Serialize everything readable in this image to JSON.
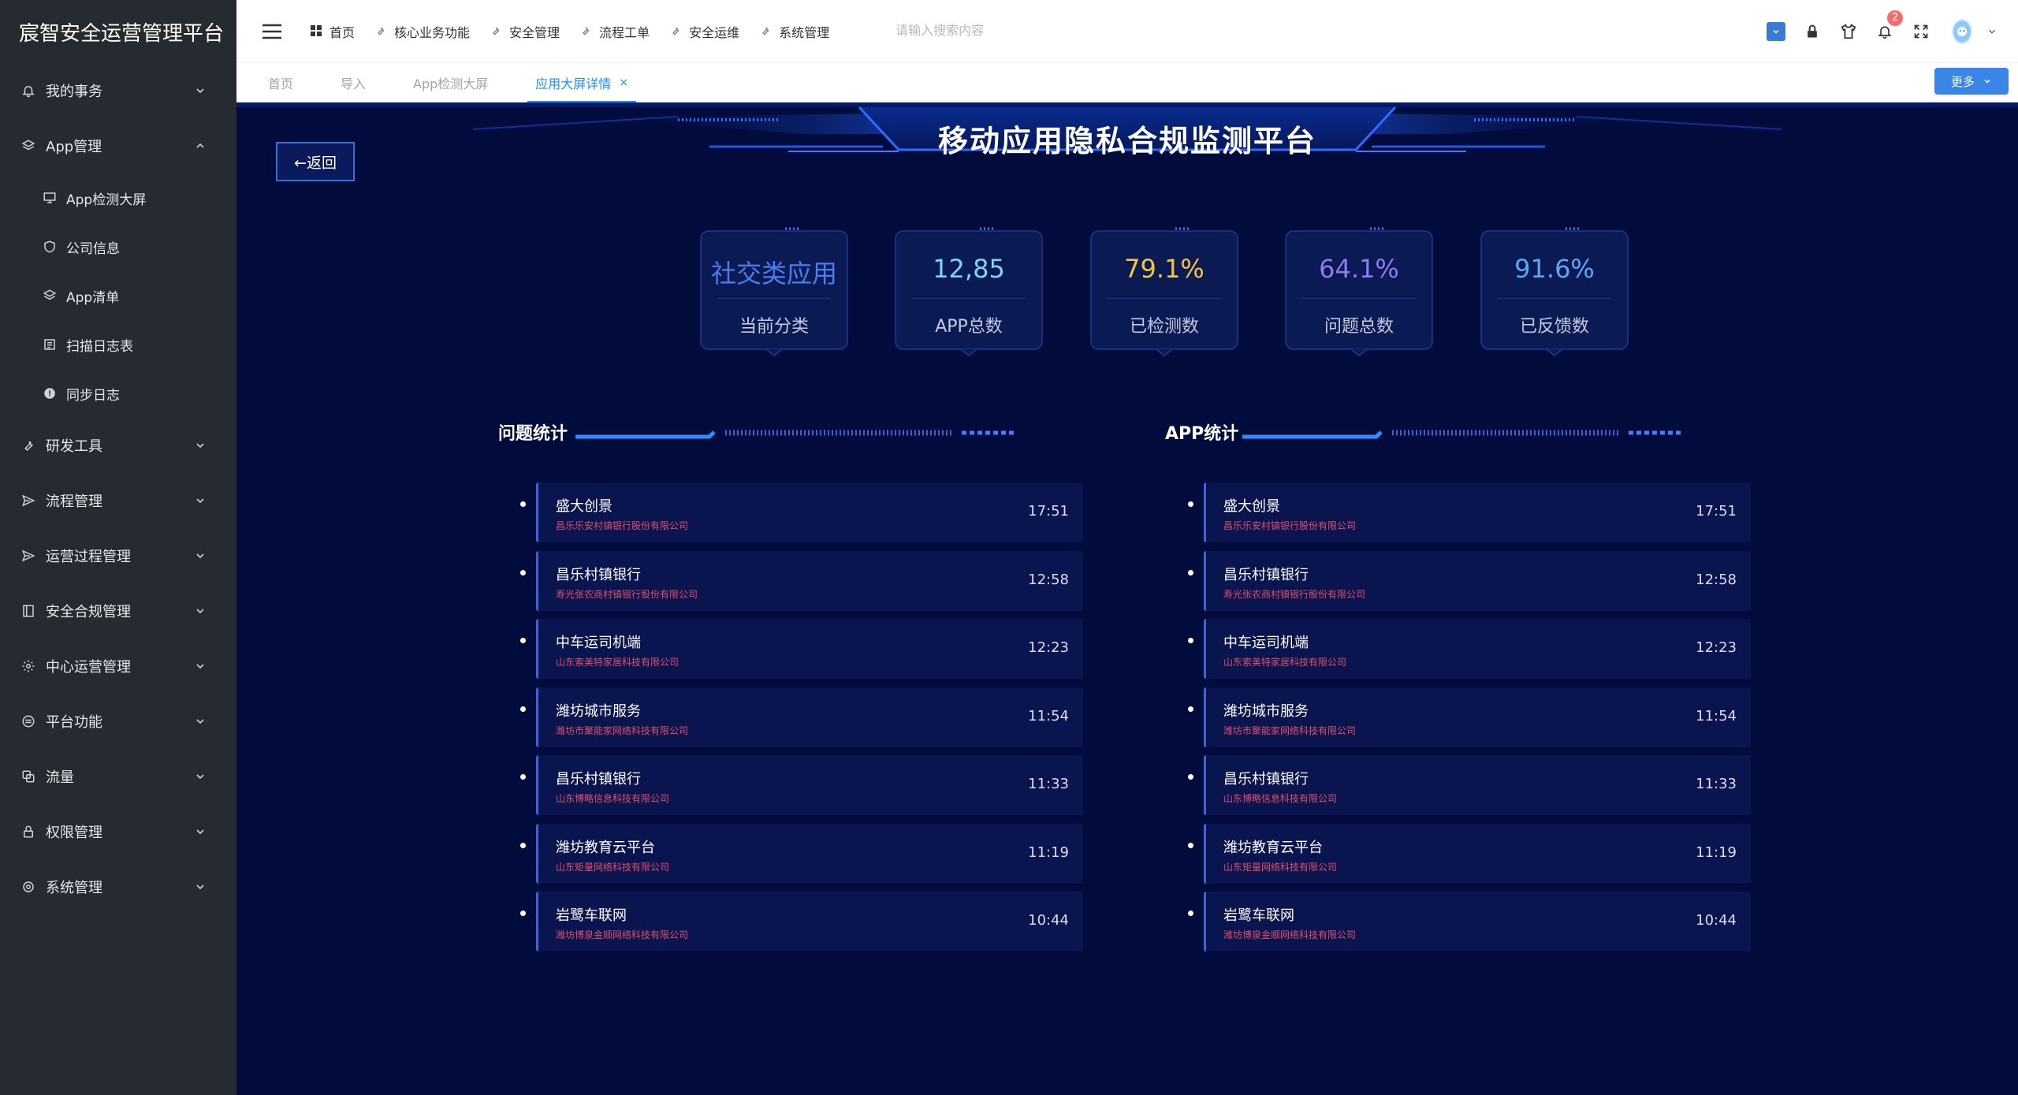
{
  "app": {
    "title": "宸智安全运营管理平台"
  },
  "sidebar": {
    "items": [
      {
        "label": "我的事务",
        "icon": "bell-icon",
        "expanded": false
      },
      {
        "label": "App管理",
        "icon": "layers-icon",
        "expanded": true,
        "children": [
          {
            "label": "App检测大屏",
            "icon": "monitor-icon"
          },
          {
            "label": "公司信息",
            "icon": "shield-icon"
          },
          {
            "label": "App清单",
            "icon": "layers-icon"
          },
          {
            "label": "扫描日志表",
            "icon": "list-icon"
          },
          {
            "label": "同步日志",
            "icon": "info-icon"
          }
        ]
      },
      {
        "label": "研发工具",
        "icon": "wrench-icon",
        "expanded": false
      },
      {
        "label": "流程管理",
        "icon": "send-icon",
        "expanded": false
      },
      {
        "label": "运营过程管理",
        "icon": "send-icon",
        "expanded": false
      },
      {
        "label": "安全合规管理",
        "icon": "book-icon",
        "expanded": false
      },
      {
        "label": "中心运营管理",
        "icon": "gear-icon",
        "expanded": false
      },
      {
        "label": "平台功能",
        "icon": "circle-lines-icon",
        "expanded": false
      },
      {
        "label": "流量",
        "icon": "copy-icon",
        "expanded": false
      },
      {
        "label": "权限管理",
        "icon": "lock-icon",
        "expanded": false
      },
      {
        "label": "系统管理",
        "icon": "gear-icon",
        "expanded": false
      }
    ]
  },
  "topnav": {
    "items": [
      {
        "label": "首页",
        "icon": "grid-icon"
      },
      {
        "label": "核心业务功能",
        "icon": "wrench-icon"
      },
      {
        "label": "安全管理",
        "icon": "wrench-icon"
      },
      {
        "label": "流程工单",
        "icon": "wrench-icon"
      },
      {
        "label": "安全运维",
        "icon": "wrench-icon"
      },
      {
        "label": "系统管理",
        "icon": "wrench-icon"
      }
    ],
    "search_placeholder": "请输入搜索内容",
    "notification_count": "2"
  },
  "tabs": {
    "items": [
      {
        "label": "首页",
        "active": false
      },
      {
        "label": "导入",
        "active": false
      },
      {
        "label": "App检测大屏",
        "active": false
      },
      {
        "label": "应用大屏详情",
        "active": true,
        "closable": true
      }
    ],
    "more_label": "更多",
    "close_glyph": "×"
  },
  "dashboard": {
    "title": "移动应用隐私合规监测平台",
    "back_label": "←返回",
    "stats": [
      {
        "value": "社交类应用",
        "label": "当前分类",
        "color": "#4a7df0"
      },
      {
        "value": "12,85",
        "label": "APP总数",
        "color": "#7fd3f5"
      },
      {
        "value": "79.1%",
        "label": "已检测数",
        "color": "#f5c542"
      },
      {
        "value": "64.1%",
        "label": "问题总数",
        "color": "#8d7cf0"
      },
      {
        "value": "91.6%",
        "label": "已反馈数",
        "color": "#5aa9f5"
      }
    ],
    "left_section": {
      "title": "问题统计",
      "rows": [
        {
          "name": "盛大创景",
          "company": "昌乐乐安村镇银行股份有限公司",
          "time": "17:51"
        },
        {
          "name": "昌乐村镇银行",
          "company": "寿光张农商村镇银行股份有限公司",
          "time": "12:58"
        },
        {
          "name": "中车运司机端",
          "company": "山东索美特家居科技有限公司",
          "time": "12:23"
        },
        {
          "name": "潍坊城市服务",
          "company": "潍坊市聚能家网络科技有限公司",
          "time": "11:54"
        },
        {
          "name": "昌乐村镇银行",
          "company": "山东博略信息科技有限公司",
          "time": "11:33"
        },
        {
          "name": "潍坊教育云平台",
          "company": "山东矩量网络科技有限公司",
          "time": "11:19"
        },
        {
          "name": "岩鹭车联网",
          "company": "潍坊博泉金顺网络科技有限公司",
          "time": "10:44"
        }
      ]
    },
    "right_section": {
      "title": "APP统计",
      "rows": [
        {
          "name": "盛大创景",
          "company": "昌乐乐安村镇银行股份有限公司",
          "time": "17:51"
        },
        {
          "name": "昌乐村镇银行",
          "company": "寿光张农商村镇银行股份有限公司",
          "time": "12:58"
        },
        {
          "name": "中车运司机端",
          "company": "山东索美特家居科技有限公司",
          "time": "12:23"
        },
        {
          "name": "潍坊城市服务",
          "company": "潍坊市聚能家网络科技有限公司",
          "time": "11:54"
        },
        {
          "name": "昌乐村镇银行",
          "company": "山东博略信息科技有限公司",
          "time": "11:33"
        },
        {
          "name": "潍坊教育云平台",
          "company": "山东矩量网络科技有限公司",
          "time": "11:19"
        },
        {
          "name": "岩鹭车联网",
          "company": "潍坊博泉金顺网络科技有限公司",
          "time": "10:44"
        }
      ]
    }
  }
}
